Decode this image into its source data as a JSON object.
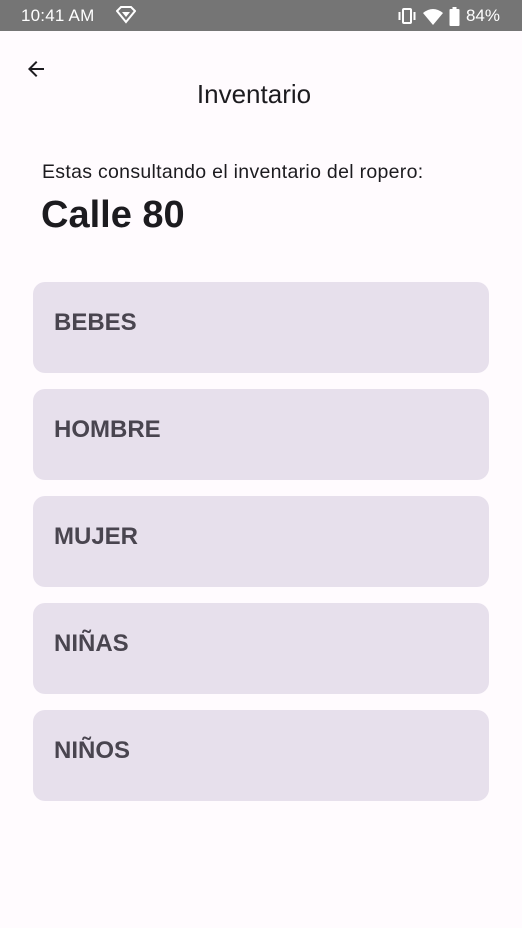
{
  "status_bar": {
    "time": "10:41 AM",
    "battery": "84%",
    "icons": [
      "notification-icon",
      "vibrate-icon",
      "wifi-icon",
      "battery-icon"
    ]
  },
  "app_bar": {
    "title": "Inventario",
    "back_icon": "arrow-back-icon"
  },
  "content": {
    "intro": "Estas consultando el inventario del ropero:",
    "wardrobe_name": "Calle 80"
  },
  "categories": [
    {
      "label": "BEBES"
    },
    {
      "label": "HOMBRE"
    },
    {
      "label": "MUJER"
    },
    {
      "label": "NIÑAS"
    },
    {
      "label": "NIÑOS"
    }
  ],
  "colors": {
    "status_bar": "#757575",
    "background": "#fffbfe",
    "card": "#e7e0ec",
    "card_text": "#49454f",
    "text": "#1c1b1f"
  }
}
